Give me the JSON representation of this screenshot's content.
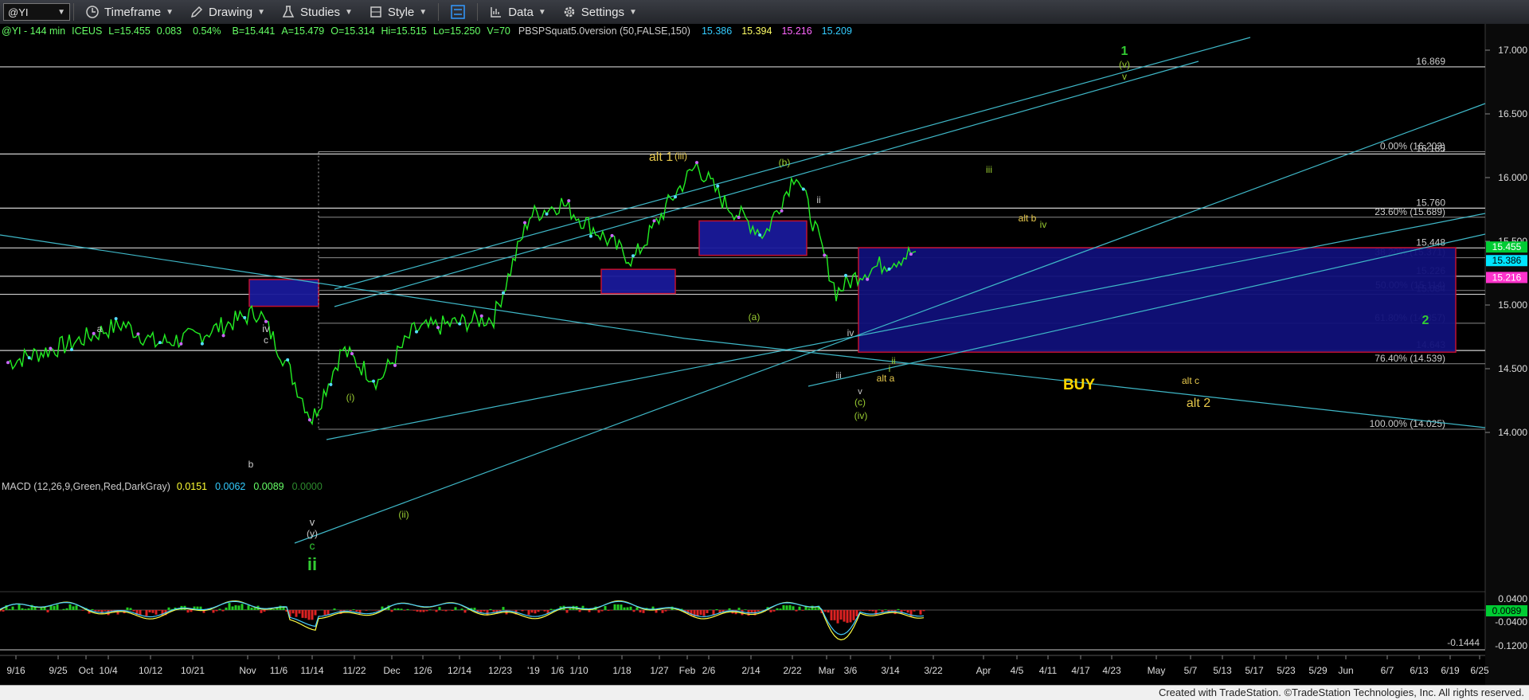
{
  "toolbar": {
    "symbol": "@YI",
    "items": [
      "Timeframe",
      "Drawing",
      "Studies",
      "Style",
      "Data",
      "Settings"
    ]
  },
  "header": {
    "symbol": "@YI",
    "interval": "144 min",
    "exchange": "ICEUS",
    "last": "L=15.455",
    "change": "0.083",
    "change_pct": "0.54%",
    "bid": "B=15.441",
    "ask": "A=15.479",
    "open": "O=15.314",
    "high": "Hi=15.515",
    "low": "Lo=15.250",
    "volume": "V=70",
    "study": "PBSPSquat5.0version (50,FALSE,150)",
    "study_values": [
      "15.386",
      "15.394",
      "15.216",
      "15.209"
    ],
    "study_colors": [
      "#33ccff",
      "#ffff66",
      "#ff66ff",
      "#33ccff"
    ]
  },
  "macd_header": {
    "label": "MACD (12,26,9,Green,Red,DarkGray)",
    "values": [
      "0.0151",
      "0.0062",
      "0.0089",
      "0.0000"
    ],
    "colors": [
      "#ffff33",
      "#33ccff",
      "#66ff66",
      "#2e8b2e"
    ]
  },
  "footer": "Created with TradeStation. ©TradeStation Technologies, Inc. All rights reserved.",
  "price_axis": {
    "ticks": [
      "17.000",
      "16.500",
      "16.000",
      "15.500",
      "15.000",
      "14.500",
      "14.000"
    ],
    "tags": [
      {
        "value": "15.455",
        "color": "#00cc33",
        "text_color": "#ffffff"
      },
      {
        "value": "15.386",
        "color": "#00e5ff",
        "text_color": "#000000"
      },
      {
        "value": "15.216",
        "color": "#ff33cc",
        "text_color": "#ffffff"
      }
    ]
  },
  "macd_axis": {
    "ticks": [
      "0.0400",
      "-0.0400",
      "-0.1200"
    ],
    "tags": [
      {
        "value": "0.0089",
        "color": "#00cc33",
        "text_color": "#000000"
      }
    ],
    "min_label": "-0.1444"
  },
  "time_axis": [
    "9/16",
    "9/25",
    "Oct",
    "10/4",
    "10/12",
    "10/21",
    "Nov",
    "11/6",
    "11/14",
    "11/22",
    "Dec",
    "12/6",
    "12/14",
    "12/23",
    "'19",
    "1/6",
    "1/10",
    "1/18",
    "1/27",
    "Feb",
    "2/6",
    "2/14",
    "2/22",
    "Mar",
    "3/6",
    "3/14",
    "3/22",
    "Apr",
    "4/5",
    "4/11",
    "4/17",
    "4/23",
    "May",
    "5/7",
    "5/13",
    "5/17",
    "5/23",
    "5/29",
    "Jun",
    "6/7",
    "6/13",
    "6/19",
    "6/25"
  ],
  "levels": [
    {
      "price": 16.869,
      "label": "16.869"
    },
    {
      "price": 16.203,
      "label": "0.00% (16.203)"
    },
    {
      "price": 16.185,
      "label": "16.185"
    },
    {
      "price": 15.76,
      "label": "15.760"
    },
    {
      "price": 15.689,
      "label": "23.60% (15.689)"
    },
    {
      "price": 15.448,
      "label": "15.448"
    },
    {
      "price": 15.371,
      "label": "38.20% (15.371)"
    },
    {
      "price": 15.226,
      "label": "15.226"
    },
    {
      "price": 15.114,
      "label": "50.00% (15.114)"
    },
    {
      "price": 15.084,
      "label": "15.084"
    },
    {
      "price": 14.857,
      "label": "61.80% (14.857)"
    },
    {
      "price": 14.643,
      "label": "14.643"
    },
    {
      "price": 14.539,
      "label": "76.40% (14.539)"
    },
    {
      "price": 14.025,
      "label": "100.00% (14.025)"
    }
  ],
  "wave_labels": [
    {
      "text": "alt 1",
      "color": "#e6c84c"
    },
    {
      "text": "(iii)",
      "color": "#e6c84c"
    },
    {
      "text": "(b)",
      "color": "#9acd32"
    },
    {
      "text": "ii",
      "color": "#cccccc"
    },
    {
      "text": "iii",
      "color": "#9acd32"
    },
    {
      "text": "alt b",
      "color": "#e6c84c"
    },
    {
      "text": "iv",
      "color": "#9acd32"
    },
    {
      "text": "1",
      "color": "#33cc33"
    },
    {
      "text": "(v)",
      "color": "#9acd32"
    },
    {
      "text": "v",
      "color": "#9acd32"
    },
    {
      "text": "a",
      "color": "#cccccc"
    },
    {
      "text": "iv",
      "color": "#cccccc"
    },
    {
      "text": "c",
      "color": "#cccccc"
    },
    {
      "text": "b",
      "color": "#cccccc"
    },
    {
      "text": "(i)",
      "color": "#9acd32"
    },
    {
      "text": "(ii)",
      "color": "#9acd32"
    },
    {
      "text": "v",
      "color": "#cccccc"
    },
    {
      "text": "(y)",
      "color": "#cccccc"
    },
    {
      "text": "c",
      "color": "#33cc33"
    },
    {
      "text": "ii",
      "color": "#33cc33"
    },
    {
      "text": "(a)",
      "color": "#9acd32"
    },
    {
      "text": "iv",
      "color": "#cccccc"
    },
    {
      "text": "iii",
      "color": "#cccccc"
    },
    {
      "text": "v",
      "color": "#cccccc"
    },
    {
      "text": "(c)",
      "color": "#9acd32"
    },
    {
      "text": "(iv)",
      "color": "#9acd32"
    },
    {
      "text": "alt a",
      "color": "#e6c84c"
    },
    {
      "text": "i",
      "color": "#9acd32"
    },
    {
      "text": "ii",
      "color": "#9acd32"
    },
    {
      "text": "2",
      "color": "#33cc33"
    },
    {
      "text": "BUY",
      "color": "#ffd700"
    },
    {
      "text": "alt c",
      "color": "#e6c84c"
    },
    {
      "text": "alt 2",
      "color": "#e6c84c"
    }
  ],
  "chart_data": {
    "type": "line",
    "title": "@YI - 144 min",
    "series": [
      {
        "name": "@YI",
        "x": [
          "9/16",
          "9/25",
          "Oct",
          "10/4",
          "10/12",
          "10/21",
          "Nov",
          "11/6",
          "11/14",
          "11/22",
          "Dec",
          "12/6",
          "12/14",
          "12/23",
          "'19",
          "1/6",
          "1/10",
          "1/18",
          "1/27",
          "Feb",
          "2/6",
          "2/14",
          "2/22",
          "Mar",
          "3/6",
          "3/14"
        ],
        "values": [
          14.55,
          14.7,
          14.8,
          14.85,
          14.7,
          14.75,
          14.95,
          14.6,
          14.1,
          14.65,
          14.4,
          14.8,
          14.85,
          14.9,
          15.7,
          15.8,
          15.6,
          15.35,
          15.85,
          16.1,
          15.8,
          15.55,
          16.05,
          15.1,
          15.25,
          15.42
        ]
      }
    ],
    "ylim": [
      13.9,
      17.15
    ],
    "macd": {
      "ylim": [
        -0.145,
        0.055
      ]
    }
  }
}
